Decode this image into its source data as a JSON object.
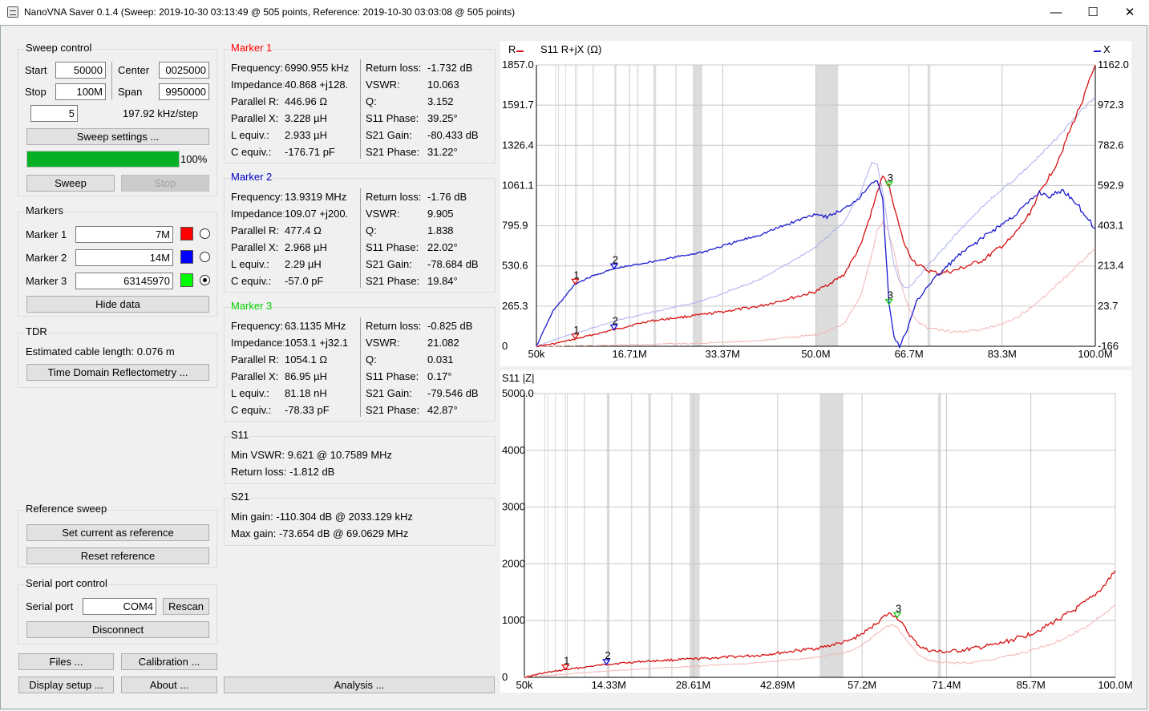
{
  "window": {
    "title": "NanoVNA Saver 0.1.4 (Sweep: 2019-10-30 03:13:49 @ 505 points, Reference: 2019-10-30 03:03:08 @ 505 points)",
    "minimize": "—",
    "maximize": "☐",
    "close": "✕"
  },
  "sweep_control": {
    "title": "Sweep control",
    "start_label": "Start",
    "start_value": "50000",
    "center_label": "Center",
    "center_value": "0025000",
    "stop_label": "Stop",
    "stop_value": "100M",
    "span_label": "Span",
    "span_value": "9950000",
    "segments_value": "5",
    "step_text": "197.92 kHz/step",
    "settings_button": "Sweep settings ...",
    "progress_percent": 100,
    "progress_text": "100%",
    "sweep_button": "Sweep",
    "stop_button": "Stop"
  },
  "markers": {
    "title": "Markers",
    "items": [
      {
        "label": "Marker 1",
        "value": "7M",
        "color": "#ff0000",
        "selected": false
      },
      {
        "label": "Marker 2",
        "value": "14M",
        "color": "#0000ff",
        "selected": false
      },
      {
        "label": "Marker 3",
        "value": "63145970",
        "color": "#00ff00",
        "selected": true
      }
    ],
    "hide_button": "Hide data"
  },
  "tdr": {
    "title": "TDR",
    "cable_text": "Estimated cable length: 0.076 m",
    "button": "Time Domain Reflectometry ..."
  },
  "reference_sweep": {
    "title": "Reference sweep",
    "set_button": "Set current as reference",
    "reset_button": "Reset reference"
  },
  "serial": {
    "title": "Serial port control",
    "port_label": "Serial port",
    "port_value": "COM4",
    "rescan_button": "Rescan",
    "disconnect_button": "Disconnect"
  },
  "bottom_buttons": {
    "files": "Files ...",
    "calibration": "Calibration ...",
    "display_setup": "Display setup ...",
    "about": "About ...",
    "analysis": "Analysis ..."
  },
  "marker_data": [
    {
      "title": "Marker 1",
      "color": "#ff0000",
      "left": [
        [
          "Frequency:",
          "6990.955 kHz"
        ],
        [
          "Impedance:",
          "40.868 +j128."
        ],
        [
          "Parallel R:",
          "446.96 Ω"
        ],
        [
          "Parallel X:",
          "3.228 µH"
        ],
        [
          "L equiv.:",
          "2.933 µH"
        ],
        [
          "C equiv.:",
          "-176.71 pF"
        ]
      ],
      "right": [
        [
          "Return loss:",
          "-1.732 dB"
        ],
        [
          "VSWR:",
          "10.063"
        ],
        [
          "Q:",
          "3.152"
        ],
        [
          "S11 Phase:",
          "39.25°"
        ],
        [
          "S21 Gain:",
          "-80.433 dB"
        ],
        [
          "S21 Phase:",
          "31.22°"
        ]
      ]
    },
    {
      "title": "Marker 2",
      "color": "#0000c8",
      "left": [
        [
          "Frequency:",
          "13.9319 MHz"
        ],
        [
          "Impedance:",
          "109.07 +j200."
        ],
        [
          "Parallel R:",
          "477.4 Ω"
        ],
        [
          "Parallel X:",
          "2.968 µH"
        ],
        [
          "L equiv.:",
          "2.29 µH"
        ],
        [
          "C equiv.:",
          "-57.0 pF"
        ]
      ],
      "right": [
        [
          "Return loss:",
          "-1.76 dB"
        ],
        [
          "VSWR:",
          "9.905"
        ],
        [
          "Q:",
          "1.838"
        ],
        [
          "S11 Phase:",
          "22.02°"
        ],
        [
          "S21 Gain:",
          "-78.684 dB"
        ],
        [
          "S21 Phase:",
          "19.84°"
        ]
      ]
    },
    {
      "title": "Marker 3",
      "color": "#00d000",
      "left": [
        [
          "Frequency:",
          "63.1135 MHz"
        ],
        [
          "Impedance:",
          "1053.1 +j32.1"
        ],
        [
          "Parallel R:",
          "1054.1 Ω"
        ],
        [
          "Parallel X:",
          "86.95 µH"
        ],
        [
          "L equiv.:",
          "81.18 nH"
        ],
        [
          "C equiv.:",
          "-78.33 pF"
        ]
      ],
      "right": [
        [
          "Return loss:",
          "-0.825 dB"
        ],
        [
          "VSWR:",
          "21.082"
        ],
        [
          "Q:",
          "0.031"
        ],
        [
          "S11 Phase:",
          "0.17°"
        ],
        [
          "S21 Gain:",
          "-79.546 dB"
        ],
        [
          "S21 Phase:",
          "42.87°"
        ]
      ]
    }
  ],
  "s11_summary": {
    "title": "S11",
    "min_vswr": "Min VSWR:  9.621 @ 10.7589 MHz",
    "return_loss": "Return loss: -1.812 dB"
  },
  "s21_summary": {
    "title": "S21",
    "min_gain": "Min gain:  -110.304 dB @ 2033.129 kHz",
    "max_gain": "Max gain:  -73.654 dB @ 69.0629 MHz"
  },
  "chart_data": [
    {
      "type": "line",
      "title": "S11  R+jX (Ω)",
      "legend_left": "R",
      "legend_right": "X",
      "x_ticks": [
        "50k",
        "16.71M",
        "33.37M",
        "50.0M",
        "66.7M",
        "83.3M",
        "100.0M"
      ],
      "xlim_mhz": [
        0.05,
        100.0
      ],
      "y_left_ticks": [
        "1857.0",
        "1591.7",
        "1326.4",
        "1061.1",
        "795.9",
        "530.6",
        "265.3",
        "0"
      ],
      "ylim_left": [
        0,
        1857.0
      ],
      "y_right_ticks": [
        "1162.0",
        "972.3",
        "782.6",
        "592.9",
        "403.1",
        "213.4",
        "23.7",
        "-166"
      ],
      "ylim_right": [
        -166,
        1162.0
      ],
      "series": [
        {
          "name": "R",
          "color": "#d81010",
          "x": [
            0.05,
            3,
            7,
            14,
            20,
            30,
            40,
            50,
            55,
            58,
            60,
            61,
            62,
            63.1,
            64,
            65,
            66,
            67,
            68,
            70,
            72,
            75,
            80,
            85,
            88,
            90,
            93,
            96,
            98,
            100
          ],
          "values": [
            0,
            15,
            48,
            110,
            165,
            210,
            265,
            360,
            470,
            660,
            890,
            1020,
            1120,
            1060,
            930,
            780,
            660,
            590,
            545,
            500,
            480,
            500,
            570,
            710,
            860,
            1010,
            1200,
            1470,
            1650,
            1857
          ]
        },
        {
          "name": "X",
          "color": "#1a1ad0",
          "x": [
            0.05,
            3,
            7,
            10,
            14,
            20,
            30,
            40,
            50,
            52,
            55,
            58,
            60,
            61,
            62,
            63.1,
            64,
            65,
            66,
            67,
            68,
            70,
            75,
            80,
            85,
            88,
            90,
            92,
            94,
            96,
            98,
            100
          ],
          "values": [
            -166,
            0,
            128,
            165,
            200,
            230,
            280,
            360,
            460,
            445,
            480,
            540,
            610,
            620,
            520,
            33,
            -120,
            -166,
            -110,
            -40,
            40,
            120,
            250,
            350,
            440,
            510,
            560,
            540,
            570,
            530,
            460,
            390
          ]
        },
        {
          "name": "R (reference)",
          "color": "#f2b4b4",
          "x": [
            0.05,
            10,
            20,
            30,
            40,
            50,
            55,
            58,
            60,
            61,
            62,
            63,
            64,
            65,
            66,
            67,
            68,
            70,
            75,
            80,
            85,
            90,
            95,
            100
          ],
          "values": [
            0,
            5,
            12,
            20,
            38,
            75,
            145,
            330,
            600,
            760,
            820,
            760,
            620,
            450,
            320,
            230,
            170,
            120,
            95,
            110,
            165,
            300,
            470,
            650
          ]
        },
        {
          "name": "X (reference)",
          "color": "#aab0ee",
          "x": [
            0.05,
            5,
            10,
            15,
            20,
            30,
            40,
            50,
            55,
            58,
            60,
            61,
            62,
            63,
            64,
            65,
            66,
            67,
            68,
            70,
            75,
            80,
            85,
            90,
            95,
            98,
            100
          ],
          "values": [
            -166,
            -120,
            -80,
            -40,
            -10,
            50,
            150,
            300,
            420,
            560,
            700,
            690,
            560,
            380,
            220,
            140,
            110,
            120,
            150,
            210,
            360,
            500,
            610,
            730,
            870,
            960,
            1010
          ]
        }
      ],
      "markers": [
        {
          "label": "1",
          "x": 6.99,
          "r": 48,
          "x_val": 128,
          "color": "#e00000"
        },
        {
          "label": "2",
          "x": 13.93,
          "r": 109,
          "x_val": 200,
          "color": "#0000e0"
        },
        {
          "label": "3",
          "x": 63.11,
          "r": 1053,
          "x_val": 32,
          "color": "#00cc00"
        }
      ],
      "bands_mhz": [
        [
          10.1,
          10.15
        ],
        [
          14.0,
          14.35
        ],
        [
          18.068,
          18.168
        ],
        [
          21.0,
          21.45
        ],
        [
          24.89,
          24.99
        ],
        [
          28.0,
          29.7
        ],
        [
          50.0,
          54.0
        ],
        [
          70.0,
          70.5
        ]
      ],
      "grid": true
    },
    {
      "type": "line",
      "title": "S11 |Z|",
      "x_ticks": [
        "50k",
        "14.33M",
        "28.61M",
        "42.89M",
        "57.2M",
        "71.4M",
        "85.7M",
        "100.0M"
      ],
      "xlim_mhz": [
        0.05,
        100.0
      ],
      "y_ticks": [
        "5000.0",
        "4000",
        "3000",
        "2000",
        "1000",
        "0"
      ],
      "ylim": [
        0,
        5000
      ],
      "series": [
        {
          "name": "|Z|",
          "color": "#d81010",
          "x": [
            0.05,
            3,
            7,
            14,
            20,
            30,
            40,
            50,
            55,
            58,
            60,
            61,
            62,
            63.1,
            64,
            65,
            66,
            67,
            68,
            70,
            72,
            75,
            80,
            85,
            88,
            90,
            93,
            96,
            98,
            100
          ],
          "values": [
            0,
            70,
            135,
            230,
            280,
            330,
            390,
            520,
            640,
            820,
            990,
            1080,
            1130,
            1053,
            930,
            780,
            640,
            540,
            490,
            450,
            450,
            490,
            580,
            740,
            880,
            1000,
            1180,
            1400,
            1600,
            1880
          ]
        },
        {
          "name": "|Z| (reference)",
          "color": "#f2b4b4",
          "x": [
            0.05,
            10,
            20,
            30,
            40,
            50,
            55,
            58,
            60,
            61,
            62,
            63,
            64,
            65,
            66,
            67,
            68,
            70,
            75,
            80,
            85,
            90,
            95,
            100
          ],
          "values": [
            0,
            80,
            150,
            200,
            260,
            360,
            460,
            620,
            800,
            880,
            920,
            880,
            760,
            620,
            480,
            380,
            320,
            260,
            250,
            330,
            450,
            620,
            880,
            1280
          ]
        }
      ],
      "markers": [
        {
          "label": "1",
          "x": 6.99,
          "y": 135,
          "color": "#e00000"
        },
        {
          "label": "2",
          "x": 13.93,
          "y": 228,
          "color": "#0000e0"
        },
        {
          "label": "3",
          "x": 63.11,
          "y": 1053,
          "color": "#00cc00"
        }
      ],
      "bands_mhz": [
        [
          10.1,
          10.15
        ],
        [
          14.0,
          14.35
        ],
        [
          18.068,
          18.168
        ],
        [
          21.0,
          21.45
        ],
        [
          24.89,
          24.99
        ],
        [
          28.0,
          29.7
        ],
        [
          50.0,
          54.0
        ],
        [
          70.0,
          70.5
        ]
      ],
      "grid": true
    }
  ]
}
